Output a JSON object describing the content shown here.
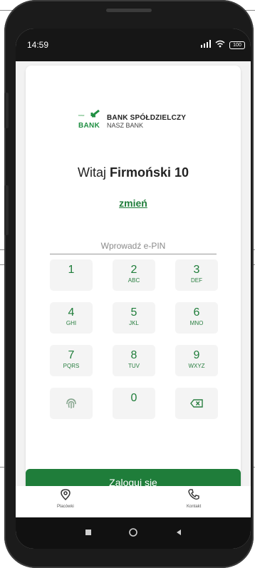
{
  "status_bar": {
    "time": "14:59",
    "battery": "100"
  },
  "brand": {
    "logo_small_text": "nasz",
    "logo_text": "BANK",
    "name_line1": "BANK SPÓŁDZIELCZY",
    "name_line2": "NASZ BANK"
  },
  "greeting": {
    "prefix": "Witaj",
    "user_name": "Firmoński 10"
  },
  "change_link": "zmień",
  "pin_label": "Wprowadź e-PIN",
  "keypad": {
    "keys": [
      {
        "digit": "1",
        "letters": ""
      },
      {
        "digit": "2",
        "letters": "ABC"
      },
      {
        "digit": "3",
        "letters": "DEF"
      },
      {
        "digit": "4",
        "letters": "GHI"
      },
      {
        "digit": "5",
        "letters": "JKL"
      },
      {
        "digit": "6",
        "letters": "MNO"
      },
      {
        "digit": "7",
        "letters": "PQRS"
      },
      {
        "digit": "8",
        "letters": "TUV"
      },
      {
        "digit": "9",
        "letters": "WXYZ"
      },
      {
        "digit": "0",
        "letters": ""
      }
    ]
  },
  "login_button": "Zaloguj się",
  "bottom_nav": {
    "items": [
      {
        "label": "Placówki",
        "icon": "location-pin-icon"
      },
      {
        "label": "Kontakt",
        "icon": "phone-icon"
      }
    ]
  },
  "colors": {
    "accent": "#1f7d3a",
    "screen_background": "#f2f2f2",
    "status_bar": "#161616"
  }
}
